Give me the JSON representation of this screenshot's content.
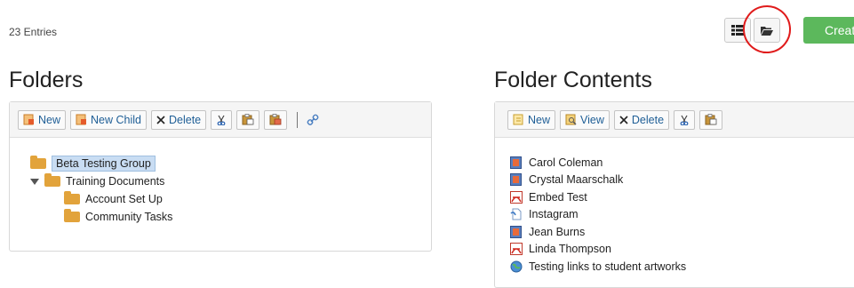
{
  "header": {
    "entries_count": "23 Entries",
    "create_label": "Create"
  },
  "folders_panel": {
    "title": "Folders",
    "toolbar": {
      "new_label": "New",
      "new_child_label": "New Child",
      "delete_label": "Delete"
    },
    "tree": {
      "root": "Beta Testing Group",
      "child": "Training Documents",
      "grandchildren": [
        "Account Set Up",
        "Community Tasks"
      ]
    }
  },
  "contents_panel": {
    "title": "Folder Contents",
    "toolbar": {
      "new_label": "New",
      "view_label": "View",
      "delete_label": "Delete"
    },
    "items": [
      {
        "name": "Carol Coleman",
        "icon": "document-icon"
      },
      {
        "name": "Crystal Maarschalk",
        "icon": "document-icon"
      },
      {
        "name": "Embed Test",
        "icon": "pdf-icon"
      },
      {
        "name": "Instagram",
        "icon": "link-icon"
      },
      {
        "name": "Jean Burns",
        "icon": "document-icon"
      },
      {
        "name": "Linda Thompson",
        "icon": "pdf-icon"
      },
      {
        "name": "Testing links to student artworks",
        "icon": "web-link-icon"
      }
    ]
  },
  "colors": {
    "create_button": "#5cb85c",
    "highlight_ring": "#e01b1b",
    "selection": "#c9ddf3",
    "folder": "#e2a33b"
  }
}
